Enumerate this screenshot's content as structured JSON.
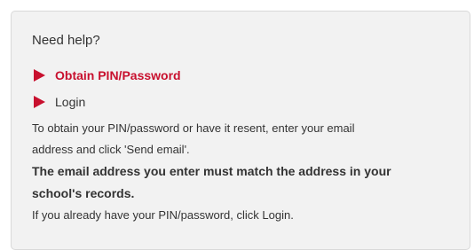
{
  "help": {
    "heading": "Need help?",
    "links": [
      {
        "label": "Obtain PIN/Password",
        "icon": "triangle-right-icon",
        "active": true
      },
      {
        "label": "Login",
        "icon": "triangle-right-icon",
        "active": false
      }
    ],
    "instructions": {
      "line1": "To obtain your PIN/password or have it resent, enter your email",
      "line2": "address and click 'Send email'.",
      "bold1": "The email address you enter must match the address in your",
      "bold2": "school's records.",
      "line3": "If you already have your PIN/password, click Login."
    }
  },
  "colors": {
    "accent": "#c8102e",
    "panel_bg": "#f2f2f2",
    "text": "#333333"
  }
}
